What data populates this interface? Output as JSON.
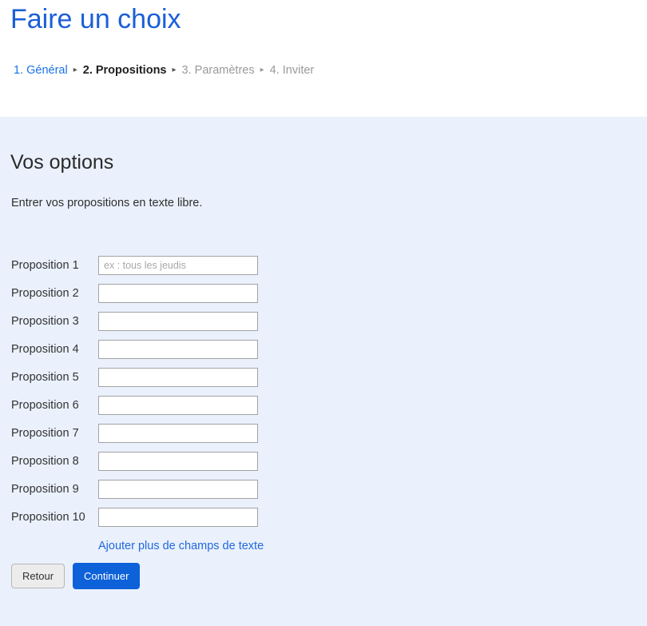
{
  "header": {
    "app_title": "Faire un choix",
    "breadcrumb": {
      "separator": "▸",
      "steps": [
        {
          "label": "1. Général",
          "state": "link"
        },
        {
          "label": "2. Propositions",
          "state": "current"
        },
        {
          "label": "3. Paramètres",
          "state": "dim"
        },
        {
          "label": "4. Inviter",
          "state": "dim"
        }
      ]
    }
  },
  "main": {
    "section_title": "Vos options",
    "section_desc": "Entrer vos propositions en texte libre.",
    "fields": [
      {
        "label": "Proposition 1",
        "value": "",
        "placeholder": "ex : tous les jeudis"
      },
      {
        "label": "Proposition 2",
        "value": "",
        "placeholder": ""
      },
      {
        "label": "Proposition 3",
        "value": "",
        "placeholder": ""
      },
      {
        "label": "Proposition 4",
        "value": "",
        "placeholder": ""
      },
      {
        "label": "Proposition 5",
        "value": "",
        "placeholder": ""
      },
      {
        "label": "Proposition 6",
        "value": "",
        "placeholder": ""
      },
      {
        "label": "Proposition 7",
        "value": "",
        "placeholder": ""
      },
      {
        "label": "Proposition 8",
        "value": "",
        "placeholder": ""
      },
      {
        "label": "Proposition 9",
        "value": "",
        "placeholder": ""
      },
      {
        "label": "Proposition 10",
        "value": "",
        "placeholder": ""
      }
    ],
    "add_fields_link": "Ajouter plus de champs de texte"
  },
  "footer": {
    "back_label": "Retour",
    "continue_label": "Continuer"
  },
  "colors": {
    "title_blue": "#1a5fd9",
    "link_blue": "#2268e0",
    "primary_button": "#0d61d9",
    "panel_background": "#eaf1fc",
    "header_background": "#ffffff"
  }
}
